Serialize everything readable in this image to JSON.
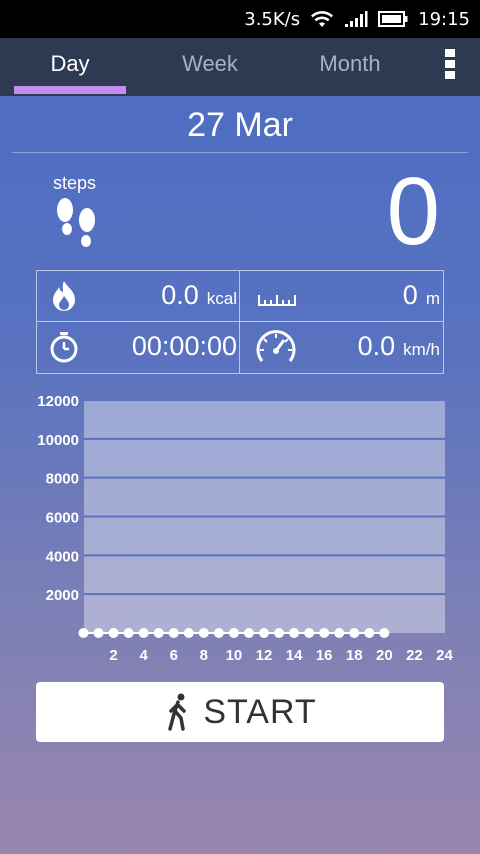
{
  "status_bar": {
    "speed": "3.5K/s",
    "time": "19:15",
    "icons": [
      "wifi-icon",
      "signal-icon",
      "battery-icon"
    ]
  },
  "tabs": [
    {
      "label": "Day",
      "active": true
    },
    {
      "label": "Week",
      "active": false
    },
    {
      "label": "Month",
      "active": false
    }
  ],
  "date": "27 Mar",
  "steps": {
    "label": "steps",
    "value": "0",
    "icon": "footprints-icon"
  },
  "stats": {
    "calories": {
      "value": "0.0",
      "unit": "kcal",
      "icon": "flame-icon"
    },
    "distance": {
      "value": "0",
      "unit": "m",
      "icon": "ruler-icon"
    },
    "duration": {
      "value": "00:00:00",
      "icon": "stopwatch-icon"
    },
    "speed": {
      "value": "0.0",
      "unit": "km/h",
      "icon": "speedometer-icon"
    }
  },
  "chart_data": {
    "type": "line",
    "x": [
      0,
      1,
      2,
      3,
      4,
      5,
      6,
      7,
      8,
      9,
      10,
      11,
      12,
      13,
      14,
      15,
      16,
      17,
      18,
      19,
      20
    ],
    "values": [
      0,
      0,
      0,
      0,
      0,
      0,
      0,
      0,
      0,
      0,
      0,
      0,
      0,
      0,
      0,
      0,
      0,
      0,
      0,
      0,
      0
    ],
    "x_ticks": [
      "2",
      "4",
      "6",
      "8",
      "10",
      "12",
      "14",
      "16",
      "18",
      "20",
      "22",
      "24"
    ],
    "y_ticks": [
      "2000",
      "4000",
      "6000",
      "8000",
      "10000",
      "12000"
    ],
    "xlim": [
      0,
      24
    ],
    "ylim": [
      0,
      12000
    ],
    "grid": true
  },
  "start_button": {
    "label": "START",
    "icon": "walking-person-icon"
  },
  "colors": {
    "tab_indicator": "#c58cf0",
    "tabbar_bg": "#2e3a52"
  }
}
